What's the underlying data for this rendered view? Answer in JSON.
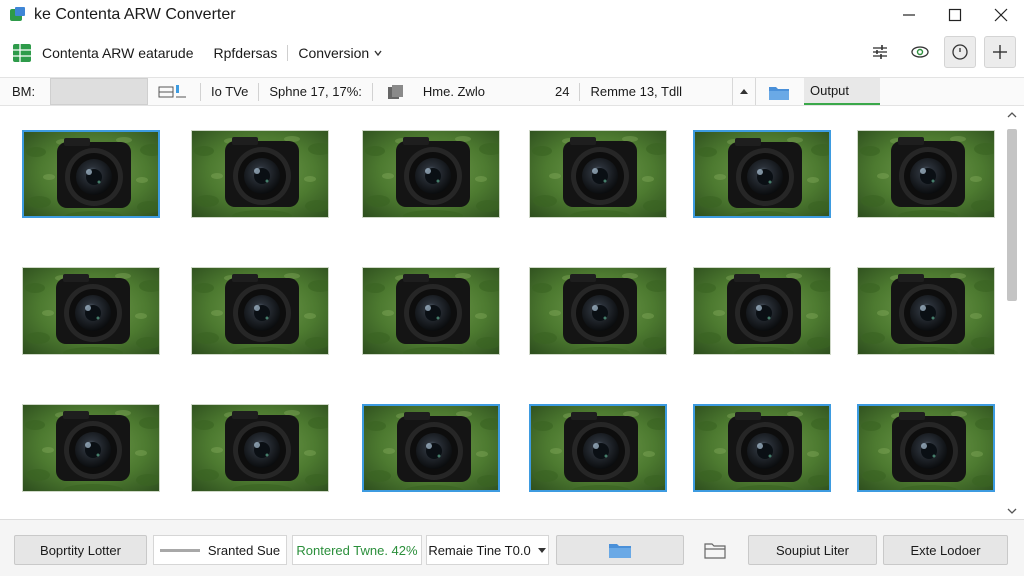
{
  "window": {
    "title": "ke Contenta ARW Converter"
  },
  "menu": {
    "app_name": "Contenta ARW eatarude",
    "item2": "Rpfdersas",
    "conversion": "Conversion"
  },
  "infobar": {
    "label": "BM:",
    "type_label": "Io TVe",
    "sphere_text": "Sphne 17, 17%:",
    "time_text": "Hme. Zwlo",
    "count": "24",
    "remaining_text": "Remme 13, Tdll",
    "output_label": "Output"
  },
  "thumbnails": {
    "rows": 3,
    "cols": 6,
    "selected": [
      0,
      4,
      14,
      15,
      16,
      17
    ]
  },
  "bottombar": {
    "priority_folder": "Boprtity Lotter",
    "started_size": "Sranted Sue",
    "rendered_time": "Rontered Twne. 42%",
    "remaining_time": "Remaie Tine T0.0",
    "output_filter": "Soupiut Liter",
    "exit_folder": "Exte Lodoer"
  },
  "colors": {
    "accent_green": "#2b8f3b",
    "selection_blue": "#3d9be0",
    "folder_blue": "#4a90d9"
  },
  "icons": [
    "app-icon",
    "spreadsheet-icon",
    "chevron-down-icon",
    "sliders-icon",
    "eye-icon",
    "clock-icon",
    "plus-icon",
    "minimize-icon",
    "maximize-icon",
    "close-icon",
    "folder-icon",
    "chevron-up-icon"
  ]
}
